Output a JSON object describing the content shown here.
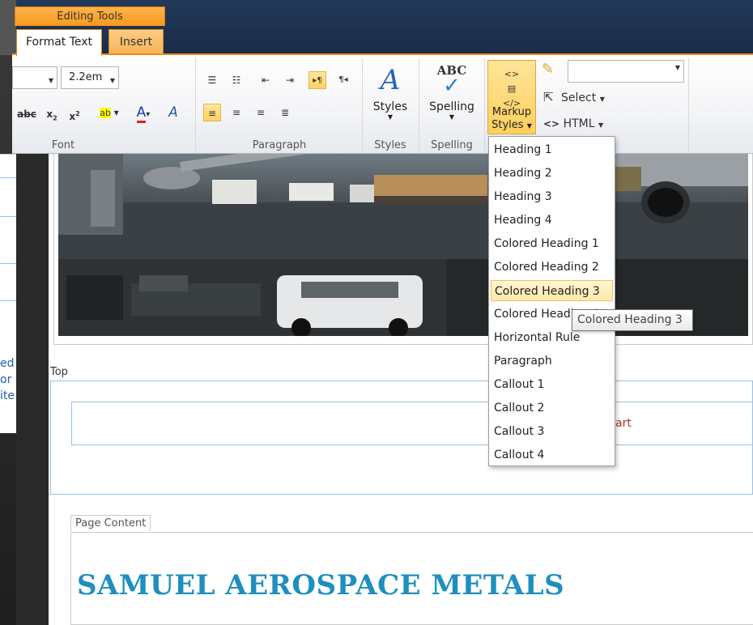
{
  "ribbon": {
    "contextual_group": "Editing Tools",
    "tabs": [
      {
        "label": "Format Text",
        "selected": true
      },
      {
        "label": "Insert",
        "selected": false
      }
    ],
    "font_size": "2.2em",
    "groups": {
      "font": "Font",
      "paragraph": "Paragraph",
      "styles": "Styles",
      "spelling": "Spelling"
    },
    "buttons": {
      "styles": "Styles",
      "spelling": "Spelling",
      "spelling_icon_text": "ABC",
      "markup_line1": "Markup",
      "markup_line2": "Styles",
      "select": "Select",
      "html": "HTML"
    },
    "font_buttons": {
      "strike": "abc",
      "subscript": "x",
      "superscript": "x",
      "highlight": "ab",
      "font_color": "A",
      "clear": "A"
    },
    "accent_color": "#f28a14"
  },
  "markup_menu": {
    "items": [
      "Heading 1",
      "Heading 2",
      "Heading 3",
      "Heading 4",
      "Colored Heading 1",
      "Colored Heading 2",
      "Colored Heading 3",
      "Colored Heading 4",
      "Horizontal Rule",
      "Paragraph",
      "Callout 1",
      "Callout 2",
      "Callout 3",
      "Callout 4"
    ],
    "hovered_index": 6,
    "tooltip": "Colored Heading 3"
  },
  "page": {
    "zone_label": "Top",
    "zone_link_text": "art",
    "content_tab": "Page Content",
    "content_title": "SAMUEL AEROSPACE METALS",
    "title_color": "#1e8fbf"
  },
  "behind_panel": {
    "lines": [
      "ed",
      "or",
      "ite"
    ]
  }
}
